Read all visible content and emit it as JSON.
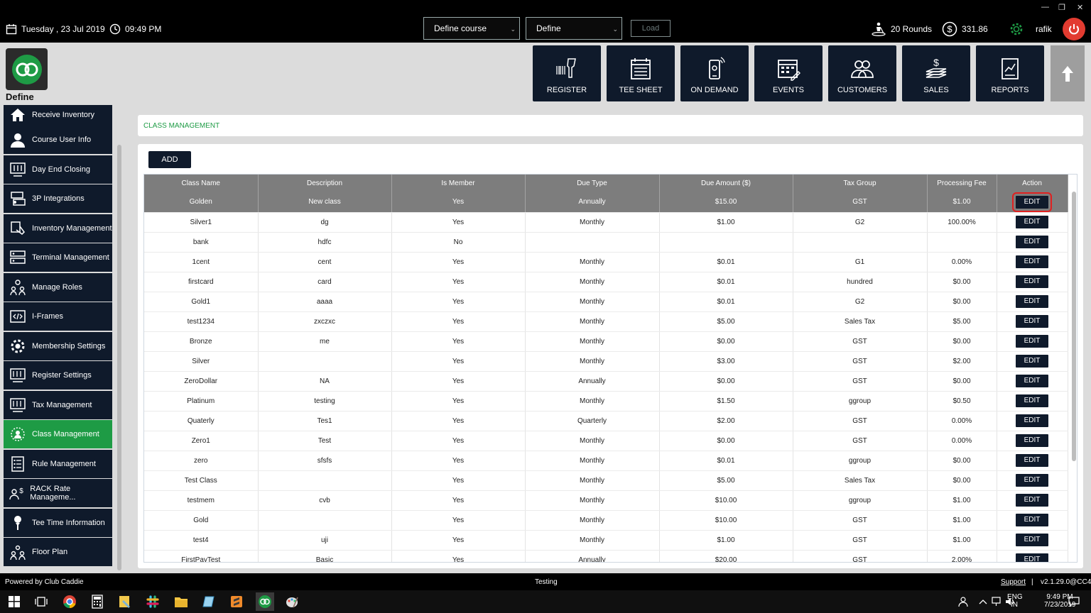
{
  "topbar": {
    "date": "Tuesday ,  23 Jul 2019",
    "time": "09:49 PM",
    "course_select": "Define course",
    "define_select": "Define",
    "load_label": "Load",
    "rounds": "20 Rounds",
    "balance": "331.86",
    "user": "rafik"
  },
  "header": {
    "brand": "Define",
    "nav": [
      "REGISTER",
      "TEE SHEET",
      "ON DEMAND",
      "EVENTS",
      "CUSTOMERS",
      "SALES",
      "REPORTS"
    ]
  },
  "sidebar": {
    "items": [
      "Receive Inventory",
      "Course User Info",
      "Day End Closing",
      "3P Integrations",
      "Inventory Management",
      "Terminal Management",
      "Manage Roles",
      "I-Frames",
      "Membership Settings",
      "Register Settings",
      "Tax Management",
      "Class Management",
      "Rule Management",
      "RACK Rate Manageme...",
      "Tee Time Information",
      "Floor Plan"
    ],
    "active": "Class Management"
  },
  "page": {
    "title": "CLASS MANAGEMENT",
    "add_label": "ADD",
    "edit_label": "EDIT"
  },
  "table": {
    "columns": [
      "Class Name",
      "Description",
      "Is Member",
      "Due Type",
      "Due Amount ($)",
      "Tax Group",
      "Processing Fee",
      "Action"
    ],
    "rows": [
      [
        "Golden",
        "New class",
        "Yes",
        "Annually",
        "$15.00",
        "GST",
        "$1.00"
      ],
      [
        "Silver1",
        "dg",
        "Yes",
        "Monthly",
        "$1.00",
        "G2",
        "100.00%"
      ],
      [
        "bank",
        "hdfc",
        "No",
        "",
        "",
        "",
        ""
      ],
      [
        "1cent",
        "cent",
        "Yes",
        "Monthly",
        "$0.01",
        "G1",
        "0.00%"
      ],
      [
        "firstcard",
        "card",
        "Yes",
        "Monthly",
        "$0.01",
        "hundred",
        "$0.00"
      ],
      [
        "Gold1",
        "aaaa",
        "Yes",
        "Monthly",
        "$0.01",
        "G2",
        "$0.00"
      ],
      [
        "test1234",
        "zxczxc",
        "Yes",
        "Monthly",
        "$5.00",
        "Sales Tax",
        "$5.00"
      ],
      [
        "Bronze",
        "me",
        "Yes",
        "Monthly",
        "$0.00",
        "GST",
        "$0.00"
      ],
      [
        "Silver",
        "",
        "Yes",
        "Monthly",
        "$3.00",
        "GST",
        "$2.00"
      ],
      [
        "ZeroDollar",
        "NA",
        "Yes",
        "Annually",
        "$0.00",
        "GST",
        "$0.00"
      ],
      [
        "Platinum",
        "testing",
        "Yes",
        "Monthly",
        "$1.50",
        "ggroup",
        "$0.50"
      ],
      [
        "Quaterly",
        "Tes1",
        "Yes",
        "Quarterly",
        "$2.00",
        "GST",
        "0.00%"
      ],
      [
        "Zero1",
        "Test",
        "Yes",
        "Monthly",
        "$0.00",
        "GST",
        "0.00%"
      ],
      [
        "zero",
        "sfsfs",
        "Yes",
        "Monthly",
        "$0.01",
        "ggroup",
        "$0.00"
      ],
      [
        "Test Class",
        "",
        "Yes",
        "Monthly",
        "$5.00",
        "Sales Tax",
        "$0.00"
      ],
      [
        "testmem",
        "cvb",
        "Yes",
        "Monthly",
        "$10.00",
        "ggroup",
        "$1.00"
      ],
      [
        "Gold",
        "",
        "Yes",
        "Monthly",
        "$10.00",
        "GST",
        "$1.00"
      ],
      [
        "test4",
        "uji",
        "Yes",
        "Monthly",
        "$1.00",
        "GST",
        "$1.00"
      ],
      [
        "FirstPayTest",
        "Basic",
        "Yes",
        "Annually",
        "$20.00",
        "GST",
        "2.00%"
      ]
    ]
  },
  "footer": {
    "powered": "Powered by Club Caddie",
    "env": "Testing",
    "support": "Support",
    "sep": "|",
    "version": "v2.1.29.0@CC4"
  },
  "taskbar": {
    "lang1": "ENG",
    "lang2": "IN",
    "clock_time": "9:49 PM",
    "clock_date": "7/23/2019"
  },
  "colors": {
    "navy": "#0f1a2b",
    "green": "#1e9b45",
    "header_gray": "#7d7d7d",
    "highlight_red": "#e02020"
  }
}
